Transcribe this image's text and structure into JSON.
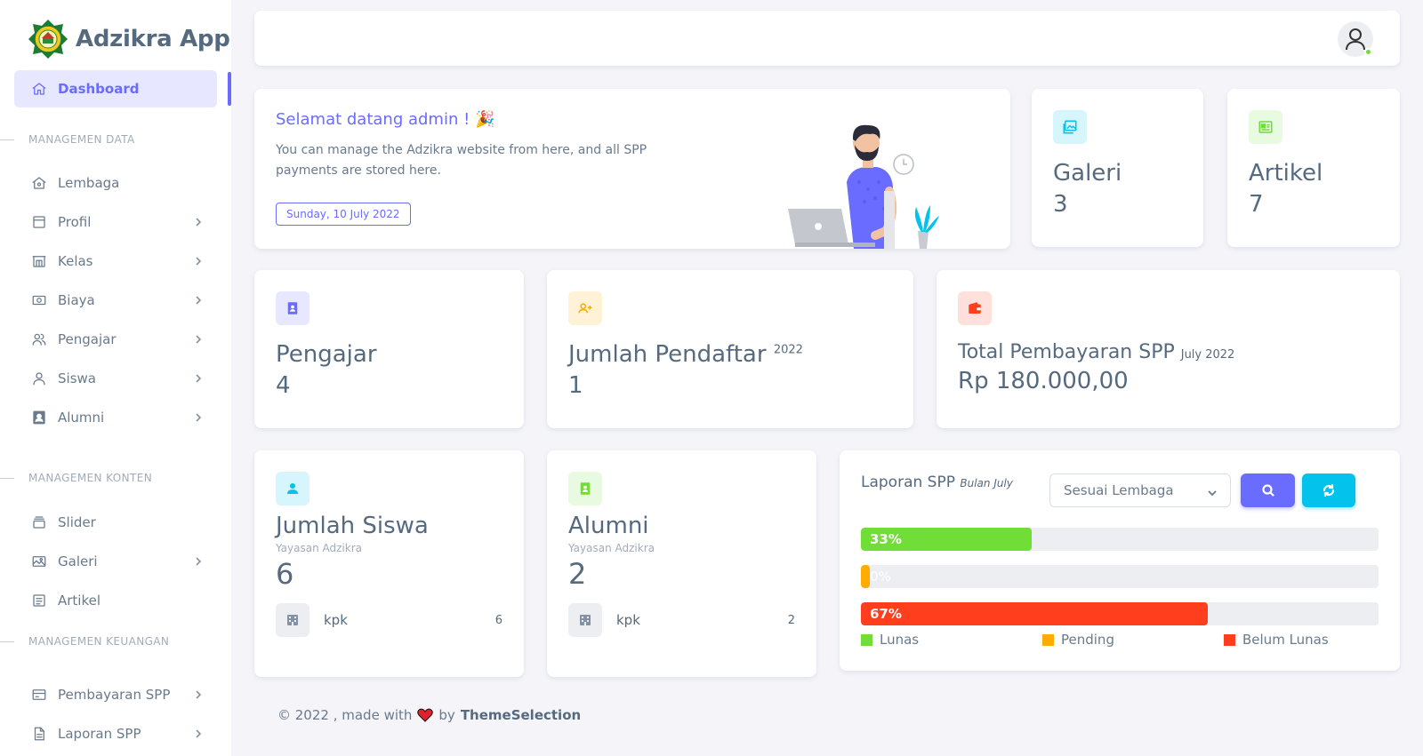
{
  "brand": {
    "name": "Adzikra App"
  },
  "sidebar": {
    "dashboard": "Dashboard",
    "headers": [
      "MANAGEMEN DATA",
      "MANAGEMEN KONTEN",
      "MANAGEMEN KEUANGAN"
    ],
    "items": [
      {
        "label": "Lembaga",
        "icon": "home-icon"
      },
      {
        "label": "Profil",
        "icon": "window-icon"
      },
      {
        "label": "Kelas",
        "icon": "building-icon"
      },
      {
        "label": "Biaya",
        "icon": "money-icon"
      },
      {
        "label": "Pengajar",
        "icon": "users-icon"
      },
      {
        "label": "Siswa",
        "icon": "user-icon"
      },
      {
        "label": "Alumni",
        "icon": "contact-icon"
      },
      {
        "label": "Slider",
        "icon": "slider-icon"
      },
      {
        "label": "Galeri",
        "icon": "image-icon"
      },
      {
        "label": "Artikel",
        "icon": "article-icon"
      },
      {
        "label": "Pembayaran SPP",
        "icon": "card-icon"
      },
      {
        "label": "Laporan SPP",
        "icon": "report-icon"
      }
    ]
  },
  "welcome": {
    "title": "Selamat datang admin !",
    "text": "You can manage the Adzikra website from here, and all SPP payments are stored here.",
    "date": "Sunday, 10 July 2022"
  },
  "stats": {
    "galeri": {
      "label": "Galeri",
      "value": "3"
    },
    "artikel": {
      "label": "Artikel",
      "value": "7"
    },
    "pengajar": {
      "label": "Pengajar",
      "value": "4"
    },
    "pendaftar": {
      "label": "Jumlah Pendaftar",
      "year": "2022",
      "value": "1"
    },
    "spp": {
      "label": "Total Pembayaran SPP",
      "period": "July 2022",
      "value": "Rp 180.000,00"
    }
  },
  "siswa": {
    "title": "Jumlah Siswa",
    "sub": "Yayasan Adzikra",
    "value": "6",
    "row_name": "kpk",
    "row_count": "6"
  },
  "alumni": {
    "title": "Alumni",
    "sub": "Yayasan Adzikra",
    "value": "2",
    "row_name": "kpk",
    "row_count": "2"
  },
  "laporan": {
    "title": "Laporan SPP",
    "subtitle": "Bulan July",
    "select": "Sesuai Lembaga",
    "bars": [
      {
        "label": "33%",
        "percent": 33,
        "color": "#71dd37"
      },
      {
        "label": "0%",
        "percent": 0,
        "color": "#ffab00"
      },
      {
        "label": "67%",
        "percent": 67,
        "color": "#ff3e1d"
      }
    ],
    "legend": [
      {
        "label": "Lunas",
        "color": "#71dd37"
      },
      {
        "label": "Pending",
        "color": "#ffab00"
      },
      {
        "label": "Belum Lunas",
        "color": "#ff3e1d"
      }
    ]
  },
  "footer": {
    "prefix": "© 2022 , made with",
    "by": "by",
    "brand": "ThemeSelection"
  },
  "colors": {
    "primary": "#696cff",
    "info": "#03c3ec",
    "success": "#71dd37",
    "warning": "#ffab00",
    "danger": "#ff3e1d"
  }
}
